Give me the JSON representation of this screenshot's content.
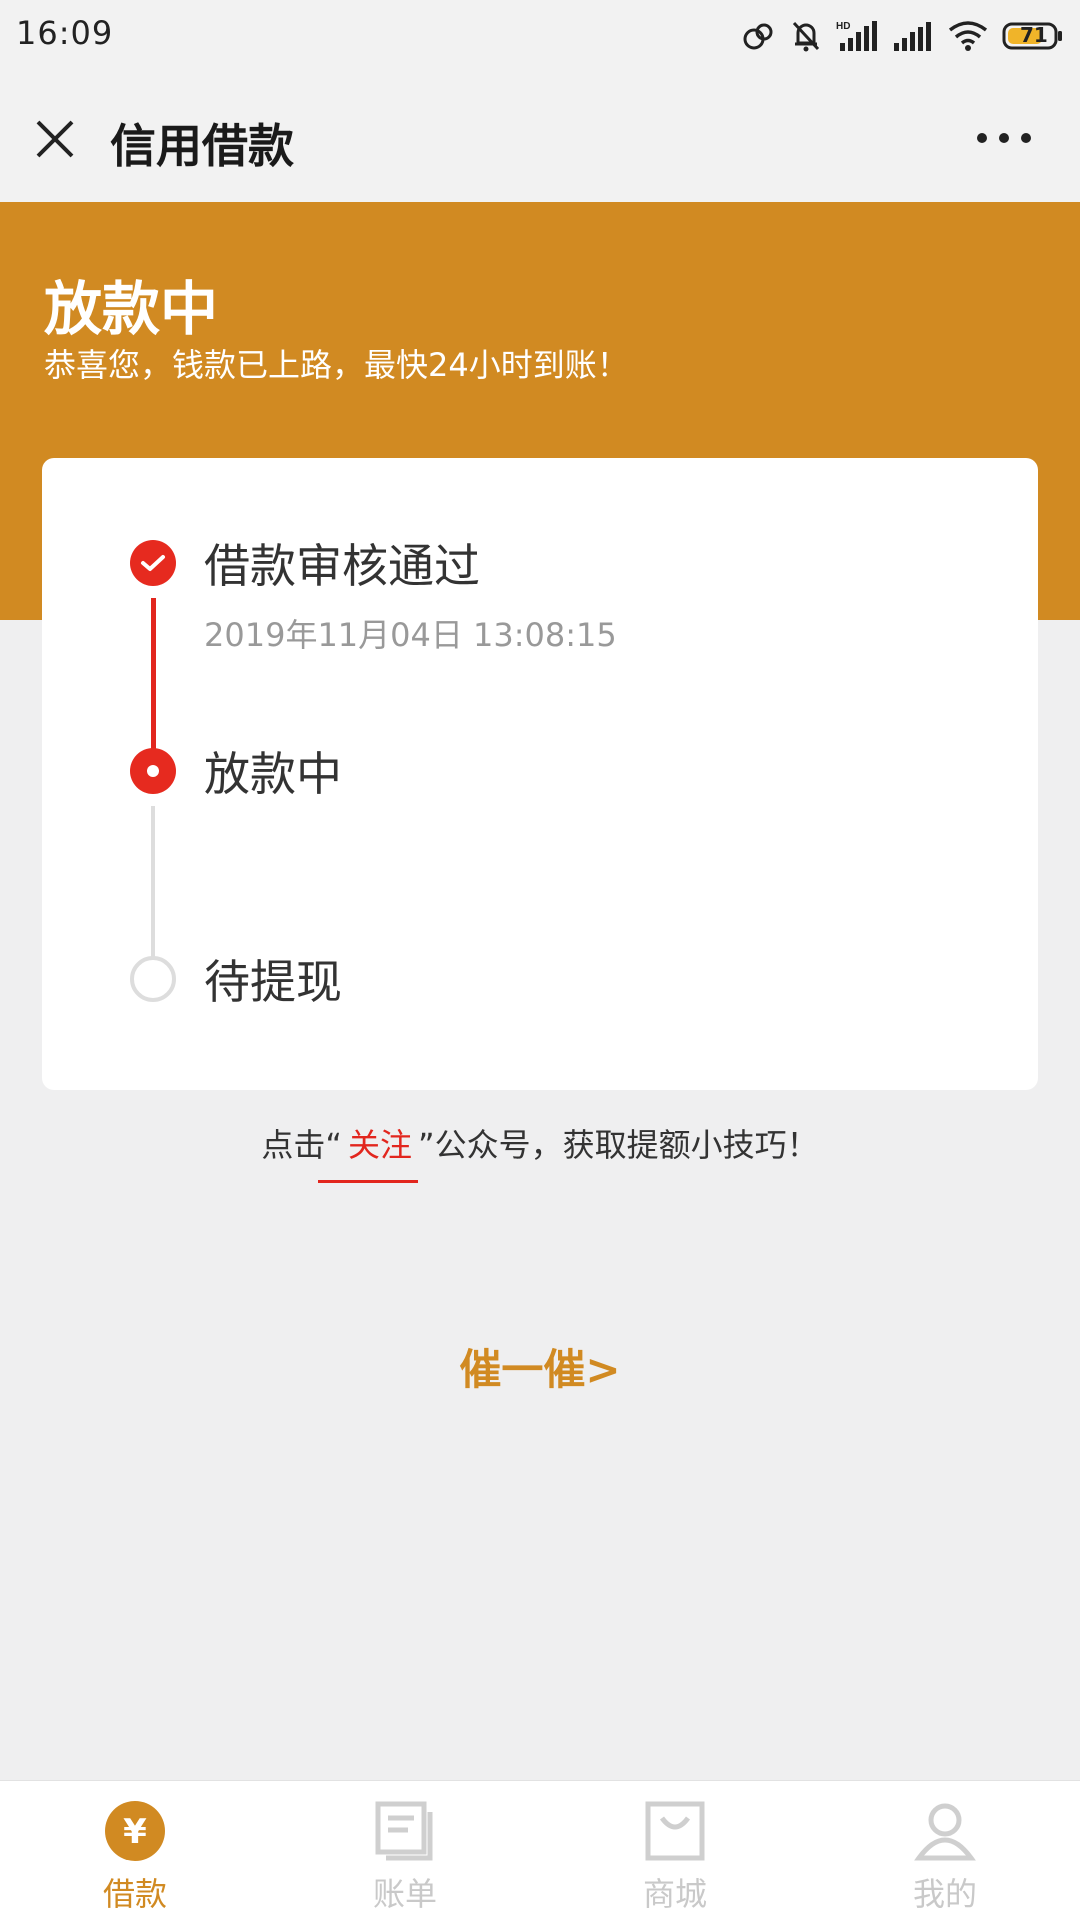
{
  "status_bar": {
    "time": "16:09",
    "icons": [
      "link-icon",
      "bell-muted-icon",
      "hd-signal-icon",
      "signal-icon",
      "wifi-icon",
      "battery-icon"
    ],
    "battery": "71"
  },
  "header": {
    "title": "信用借款"
  },
  "banner": {
    "title": "放款中",
    "subtitle": "恭喜您，钱款已上路，最快24小时到账！",
    "color": "#d18a22"
  },
  "timeline": {
    "steps": [
      {
        "label": "借款审核通过",
        "time": "2019年11月04日 13:08:15",
        "state": "done"
      },
      {
        "label": "放款中",
        "state": "current"
      },
      {
        "label": "待提现",
        "state": "pending"
      }
    ],
    "accent": "#e2261e"
  },
  "follow": {
    "prefix": "点击“",
    "link": "关注",
    "suffix": "”公众号，获取提额小技巧！"
  },
  "urge": {
    "label": "催一催>"
  },
  "bottom_nav": {
    "items": [
      {
        "label": "借款",
        "icon": "yen-icon",
        "active": true
      },
      {
        "label": "账单",
        "icon": "bill-icon",
        "active": false
      },
      {
        "label": "商城",
        "icon": "shop-bag-icon",
        "active": false
      },
      {
        "label": "我的",
        "icon": "user-icon",
        "active": false
      }
    ]
  }
}
